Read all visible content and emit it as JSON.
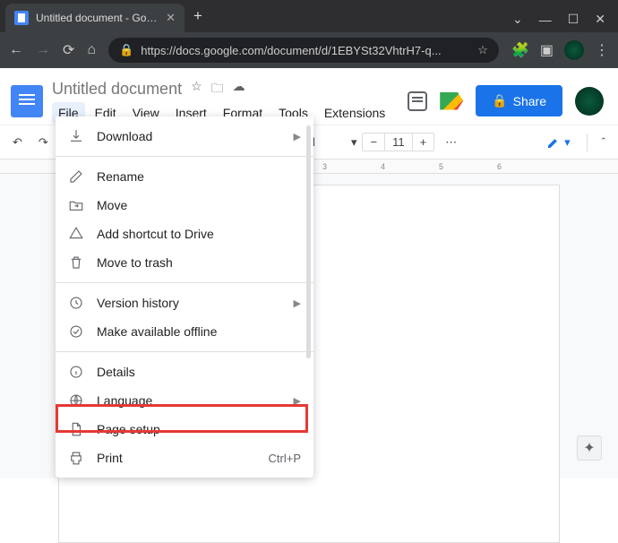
{
  "browser": {
    "tab_title": "Untitled document - Google Doc",
    "url": "https://docs.google.com/document/d/1EBYSt32VhtrH7-q..."
  },
  "header": {
    "doc_title": "Untitled document",
    "menus": [
      "File",
      "Edit",
      "View",
      "Insert",
      "Format",
      "Tools",
      "Extensions"
    ],
    "share_label": "Share"
  },
  "toolbar": {
    "style_dropdown": "al",
    "font_size": "11"
  },
  "ruler_marks": [
    "3",
    "4",
    "5",
    "6"
  ],
  "file_menu": {
    "items": [
      {
        "icon": "download",
        "label": "Download",
        "submenu": true
      },
      {
        "divider": true
      },
      {
        "icon": "rename",
        "label": "Rename"
      },
      {
        "icon": "move",
        "label": "Move"
      },
      {
        "icon": "shortcut",
        "label": "Add shortcut to Drive"
      },
      {
        "icon": "trash",
        "label": "Move to trash"
      },
      {
        "divider": true
      },
      {
        "icon": "history",
        "label": "Version history",
        "submenu": true
      },
      {
        "icon": "offline",
        "label": "Make available offline"
      },
      {
        "divider": true
      },
      {
        "icon": "details",
        "label": "Details"
      },
      {
        "icon": "language",
        "label": "Language",
        "submenu": true
      },
      {
        "icon": "page",
        "label": "Page setup"
      },
      {
        "icon": "print",
        "label": "Print",
        "shortcut": "Ctrl+P"
      }
    ]
  }
}
